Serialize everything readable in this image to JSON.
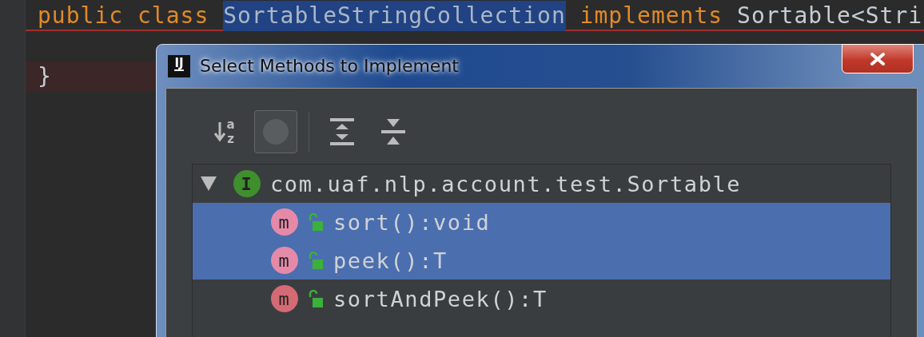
{
  "editor": {
    "lines": [
      {
        "error": true,
        "highlighted": false,
        "tokens": [
          {
            "text": "public class ",
            "kind": "keyword"
          },
          {
            "text": "SortableStringCollection",
            "kind": "selected"
          },
          {
            "text": " implements ",
            "kind": "keyword"
          },
          {
            "text": "Sortable<Stri",
            "kind": "plain"
          }
        ]
      },
      {
        "error": false,
        "highlighted": false
      },
      {
        "error": false,
        "highlighted": true,
        "tokens": [
          {
            "text": "}",
            "kind": "plain"
          }
        ]
      }
    ]
  },
  "dialog": {
    "app_icon": "IJ",
    "title": "Select Methods to Implement",
    "toolbar": [
      {
        "kind": "sort",
        "letters": [
          "a",
          "z"
        ],
        "on": false
      },
      {
        "kind": "toggle",
        "on": true
      },
      {
        "kind": "expand",
        "on": false
      },
      {
        "kind": "collapse",
        "on": false
      }
    ],
    "tree": {
      "label": "com.uaf.nlp.account.test.Sortable",
      "badge": "I",
      "expanded": true,
      "children": [
        {
          "label": "sort():void",
          "badge": "m",
          "selected": true
        },
        {
          "label": "peek():T",
          "badge": "m",
          "selected": true
        },
        {
          "label": "sortAndPeek():T",
          "badge": "m",
          "selected": false
        }
      ]
    }
  }
}
